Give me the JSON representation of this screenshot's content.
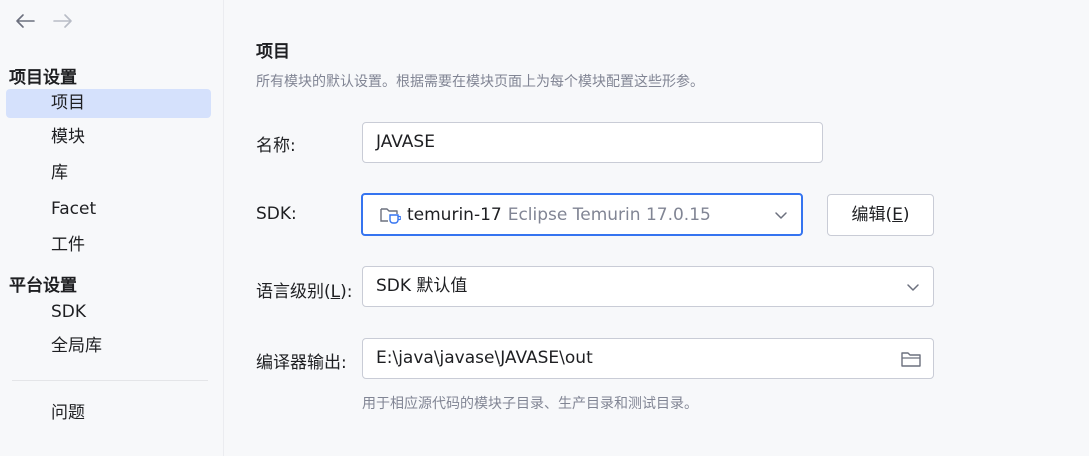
{
  "sidebar": {
    "project_settings_title": "项目设置",
    "project_items": [
      "项目",
      "模块",
      "库",
      "Facet",
      "工件"
    ],
    "platform_settings_title": "平台设置",
    "platform_items": [
      "SDK",
      "全局库"
    ],
    "problems_label": "问题",
    "selected_item": "项目"
  },
  "main": {
    "title": "项目",
    "description": "所有模块的默认设置。根据需要在模块页面上为每个模块配置这些形参。",
    "name": {
      "label": "名称:",
      "value": "JAVASE"
    },
    "sdk": {
      "label": "SDK:",
      "name": "temurin-17",
      "detail": "Eclipse Temurin 17.0.15",
      "edit_button_prefix": "编辑(",
      "edit_button_mnemonic": "E",
      "edit_button_suffix": ")"
    },
    "language_level": {
      "label_prefix": "语言级别(",
      "label_mnemonic": "L",
      "label_suffix": "):",
      "value": "SDK 默认值"
    },
    "compiler_output": {
      "label": "编译器输出:",
      "value": "E:\\java\\javase\\JAVASE\\out",
      "hint": "用于相应源代码的模块子目录、生产目录和测试目录。"
    }
  },
  "colors": {
    "accent": "#3574f0",
    "selected_bg": "#d5e1fc",
    "muted_text": "#818594",
    "border": "#c9ccd6"
  },
  "icons": [
    "arrow-back-icon",
    "arrow-forward-icon",
    "folder-jdk-icon",
    "chevron-down-icon",
    "folder-icon"
  ]
}
